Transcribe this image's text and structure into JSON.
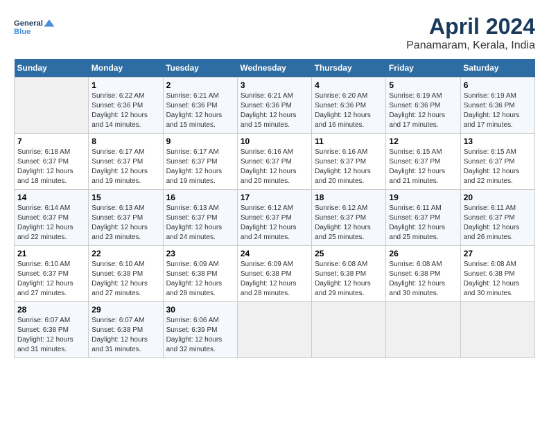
{
  "header": {
    "logo_line1": "General",
    "logo_line2": "Blue",
    "title": "April 2024",
    "subtitle": "Panamaram, Kerala, India"
  },
  "columns": [
    "Sunday",
    "Monday",
    "Tuesday",
    "Wednesday",
    "Thursday",
    "Friday",
    "Saturday"
  ],
  "weeks": [
    [
      {
        "num": "",
        "info": ""
      },
      {
        "num": "1",
        "info": "Sunrise: 6:22 AM\nSunset: 6:36 PM\nDaylight: 12 hours\nand 14 minutes."
      },
      {
        "num": "2",
        "info": "Sunrise: 6:21 AM\nSunset: 6:36 PM\nDaylight: 12 hours\nand 15 minutes."
      },
      {
        "num": "3",
        "info": "Sunrise: 6:21 AM\nSunset: 6:36 PM\nDaylight: 12 hours\nand 15 minutes."
      },
      {
        "num": "4",
        "info": "Sunrise: 6:20 AM\nSunset: 6:36 PM\nDaylight: 12 hours\nand 16 minutes."
      },
      {
        "num": "5",
        "info": "Sunrise: 6:19 AM\nSunset: 6:36 PM\nDaylight: 12 hours\nand 17 minutes."
      },
      {
        "num": "6",
        "info": "Sunrise: 6:19 AM\nSunset: 6:36 PM\nDaylight: 12 hours\nand 17 minutes."
      }
    ],
    [
      {
        "num": "7",
        "info": "Sunrise: 6:18 AM\nSunset: 6:37 PM\nDaylight: 12 hours\nand 18 minutes."
      },
      {
        "num": "8",
        "info": "Sunrise: 6:17 AM\nSunset: 6:37 PM\nDaylight: 12 hours\nand 19 minutes."
      },
      {
        "num": "9",
        "info": "Sunrise: 6:17 AM\nSunset: 6:37 PM\nDaylight: 12 hours\nand 19 minutes."
      },
      {
        "num": "10",
        "info": "Sunrise: 6:16 AM\nSunset: 6:37 PM\nDaylight: 12 hours\nand 20 minutes."
      },
      {
        "num": "11",
        "info": "Sunrise: 6:16 AM\nSunset: 6:37 PM\nDaylight: 12 hours\nand 20 minutes."
      },
      {
        "num": "12",
        "info": "Sunrise: 6:15 AM\nSunset: 6:37 PM\nDaylight: 12 hours\nand 21 minutes."
      },
      {
        "num": "13",
        "info": "Sunrise: 6:15 AM\nSunset: 6:37 PM\nDaylight: 12 hours\nand 22 minutes."
      }
    ],
    [
      {
        "num": "14",
        "info": "Sunrise: 6:14 AM\nSunset: 6:37 PM\nDaylight: 12 hours\nand 22 minutes."
      },
      {
        "num": "15",
        "info": "Sunrise: 6:13 AM\nSunset: 6:37 PM\nDaylight: 12 hours\nand 23 minutes."
      },
      {
        "num": "16",
        "info": "Sunrise: 6:13 AM\nSunset: 6:37 PM\nDaylight: 12 hours\nand 24 minutes."
      },
      {
        "num": "17",
        "info": "Sunrise: 6:12 AM\nSunset: 6:37 PM\nDaylight: 12 hours\nand 24 minutes."
      },
      {
        "num": "18",
        "info": "Sunrise: 6:12 AM\nSunset: 6:37 PM\nDaylight: 12 hours\nand 25 minutes."
      },
      {
        "num": "19",
        "info": "Sunrise: 6:11 AM\nSunset: 6:37 PM\nDaylight: 12 hours\nand 25 minutes."
      },
      {
        "num": "20",
        "info": "Sunrise: 6:11 AM\nSunset: 6:37 PM\nDaylight: 12 hours\nand 26 minutes."
      }
    ],
    [
      {
        "num": "21",
        "info": "Sunrise: 6:10 AM\nSunset: 6:37 PM\nDaylight: 12 hours\nand 27 minutes."
      },
      {
        "num": "22",
        "info": "Sunrise: 6:10 AM\nSunset: 6:38 PM\nDaylight: 12 hours\nand 27 minutes."
      },
      {
        "num": "23",
        "info": "Sunrise: 6:09 AM\nSunset: 6:38 PM\nDaylight: 12 hours\nand 28 minutes."
      },
      {
        "num": "24",
        "info": "Sunrise: 6:09 AM\nSunset: 6:38 PM\nDaylight: 12 hours\nand 28 minutes."
      },
      {
        "num": "25",
        "info": "Sunrise: 6:08 AM\nSunset: 6:38 PM\nDaylight: 12 hours\nand 29 minutes."
      },
      {
        "num": "26",
        "info": "Sunrise: 6:08 AM\nSunset: 6:38 PM\nDaylight: 12 hours\nand 30 minutes."
      },
      {
        "num": "27",
        "info": "Sunrise: 6:08 AM\nSunset: 6:38 PM\nDaylight: 12 hours\nand 30 minutes."
      }
    ],
    [
      {
        "num": "28",
        "info": "Sunrise: 6:07 AM\nSunset: 6:38 PM\nDaylight: 12 hours\nand 31 minutes."
      },
      {
        "num": "29",
        "info": "Sunrise: 6:07 AM\nSunset: 6:38 PM\nDaylight: 12 hours\nand 31 minutes."
      },
      {
        "num": "30",
        "info": "Sunrise: 6:06 AM\nSunset: 6:39 PM\nDaylight: 12 hours\nand 32 minutes."
      },
      {
        "num": "",
        "info": ""
      },
      {
        "num": "",
        "info": ""
      },
      {
        "num": "",
        "info": ""
      },
      {
        "num": "",
        "info": ""
      }
    ]
  ]
}
